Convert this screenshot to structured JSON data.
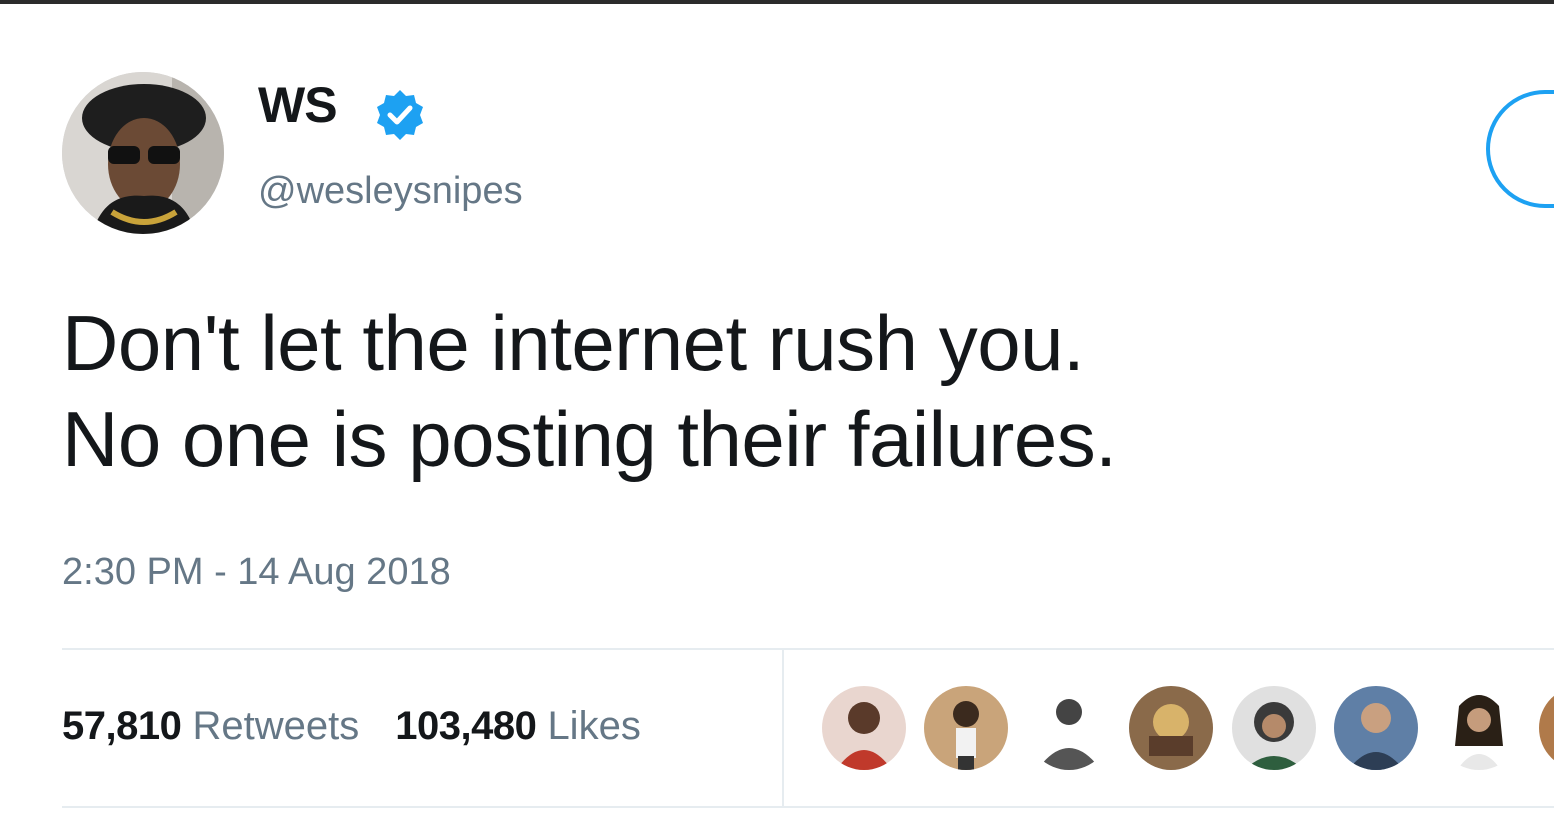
{
  "tweet": {
    "author": {
      "display_name": "WS",
      "handle": "@wesleysnipes",
      "verified": true,
      "avatar_icon": "user-avatar"
    },
    "text_lines": [
      "Don't let the internet rush you.",
      "No one is posting their failures."
    ],
    "timestamp": "2:30 PM - 14 Aug 2018",
    "stats": {
      "retweets_count": "57,810",
      "retweets_label": "Retweets",
      "likes_count": "103,480",
      "likes_label": "Likes"
    },
    "liked_by_avatars": 8
  },
  "colors": {
    "text_primary": "#14171a",
    "text_secondary": "#657786",
    "accent": "#1da1f2",
    "divider": "#e6ecf0"
  }
}
